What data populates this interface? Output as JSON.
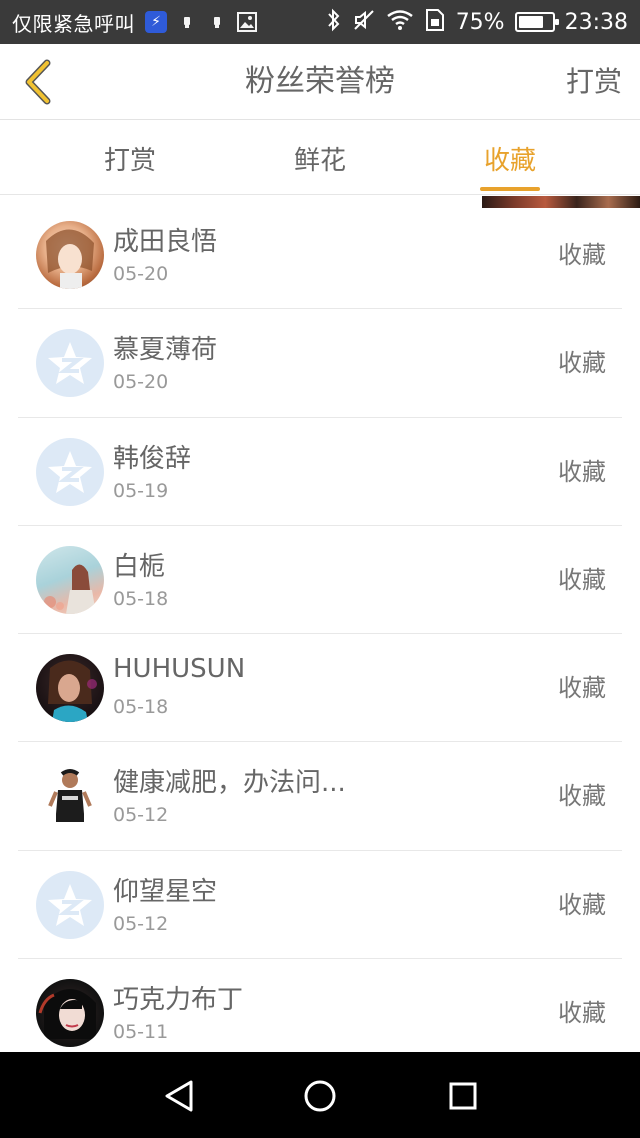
{
  "status_bar": {
    "carrier": "仅限紧急呼叫",
    "battery_percent": "75%",
    "battery_level": 0.75,
    "time": "23:38",
    "icons": [
      "flash-icon",
      "usb-icon",
      "usb-icon",
      "image-icon",
      "bluetooth-icon",
      "mute-icon",
      "wifi-icon",
      "sim-icon"
    ]
  },
  "header": {
    "title": "粉丝荣誉榜",
    "right_action": "打赏"
  },
  "tabs": [
    {
      "label": "打赏",
      "active": false
    },
    {
      "label": "鲜花",
      "active": false
    },
    {
      "label": "收藏",
      "active": true
    }
  ],
  "accent_color": "#e8a22c",
  "list": [
    {
      "name": "成田良悟",
      "date": "05-20",
      "action": "收藏",
      "avatar": "photo-avatar"
    },
    {
      "name": "慕夏薄荷",
      "date": "05-20",
      "action": "收藏",
      "avatar": "default-avatar"
    },
    {
      "name": "韩俊辞",
      "date": "05-19",
      "action": "收藏",
      "avatar": "default-avatar"
    },
    {
      "name": "白栀",
      "date": "05-18",
      "action": "收藏",
      "avatar": "photo-avatar"
    },
    {
      "name": "HUHUSUN",
      "date": "05-18",
      "action": "收藏",
      "avatar": "photo-avatar"
    },
    {
      "name": "健康减肥，办法问...",
      "date": "05-12",
      "action": "收藏",
      "avatar": "photo-avatar"
    },
    {
      "name": "仰望星空",
      "date": "05-12",
      "action": "收藏",
      "avatar": "default-avatar"
    },
    {
      "name": "巧克力布丁",
      "date": "05-11",
      "action": "收藏",
      "avatar": "photo-avatar"
    }
  ],
  "nav_bar": {
    "buttons": [
      "back-triangle-icon",
      "home-circle-icon",
      "recents-square-icon"
    ]
  }
}
